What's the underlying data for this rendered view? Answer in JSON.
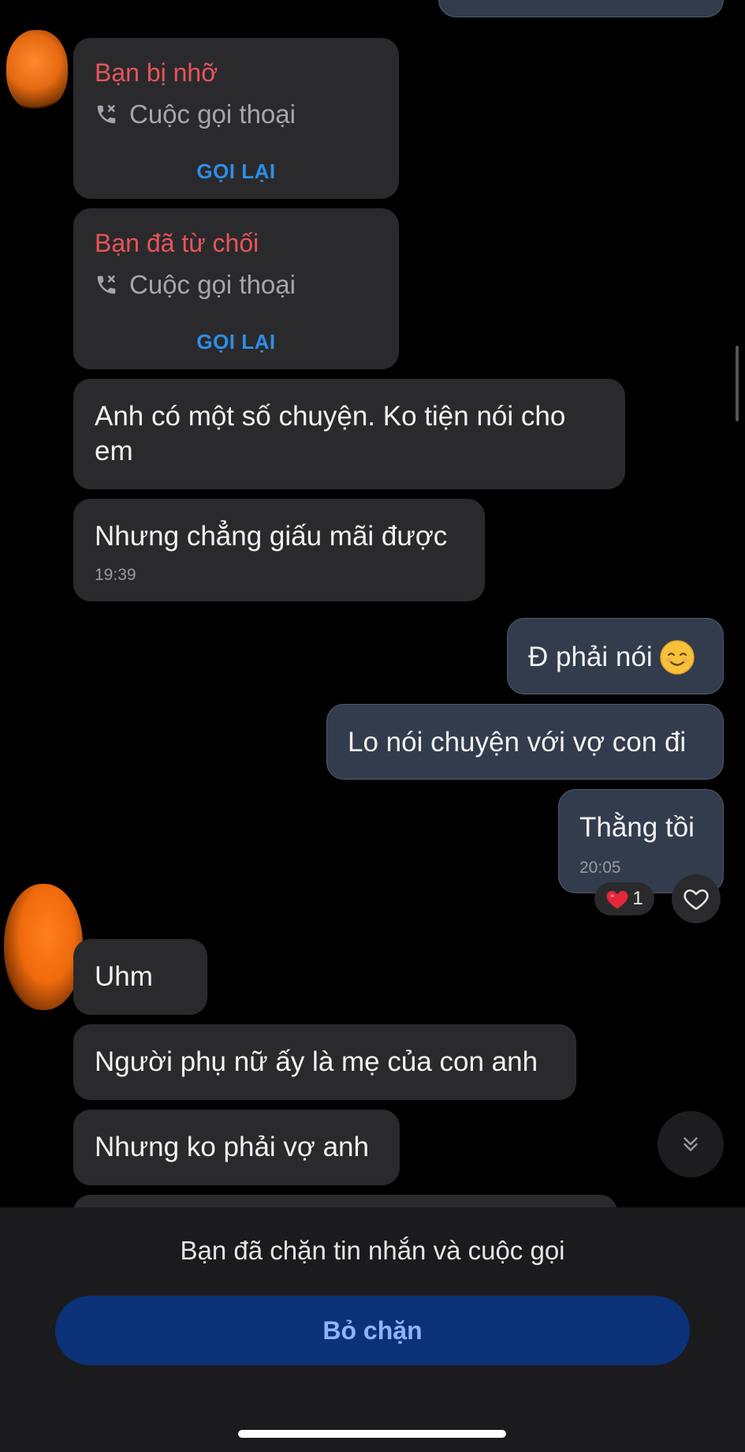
{
  "calls": [
    {
      "title": "Bạn bị nhỡ",
      "subtitle": "Cuộc gọi thoại",
      "action": "GỌI LẠI"
    },
    {
      "title": "Bạn đã từ chối",
      "subtitle": "Cuộc gọi thoại",
      "action": "GỌI LẠI"
    }
  ],
  "incoming_block1": [
    {
      "text": "Anh có một số chuyện. Ko tiện nói cho em"
    },
    {
      "text": "Nhưng chẳng giấu mãi được",
      "time": "19:39"
    }
  ],
  "outgoing": [
    {
      "text": "Đ phải nói",
      "emoji": "smiling-face-emoji"
    },
    {
      "text": "Lo nói chuyện với vợ con đi"
    },
    {
      "text": "Thằng tồi",
      "time": "20:05"
    }
  ],
  "reaction": {
    "emoji": "red-heart",
    "count": "1"
  },
  "incoming_block2": [
    {
      "text": "Uhm"
    },
    {
      "text": "Người phụ nữ ấy là mẹ của con anh"
    },
    {
      "text": "Nhưng ko phải vợ anh"
    }
  ],
  "footer": {
    "blocked_notice": "Bạn đã chặn tin nhắn và cuộc gọi",
    "unblock_label": "Bỏ chặn"
  },
  "colors": {
    "background": "#000000",
    "incoming_bubble": "#2a2a2c",
    "outgoing_bubble": "#333c4d",
    "missed_call_red": "#e8545a",
    "call_back_blue": "#2e8ee8",
    "unblock_button": "#0b3178"
  }
}
